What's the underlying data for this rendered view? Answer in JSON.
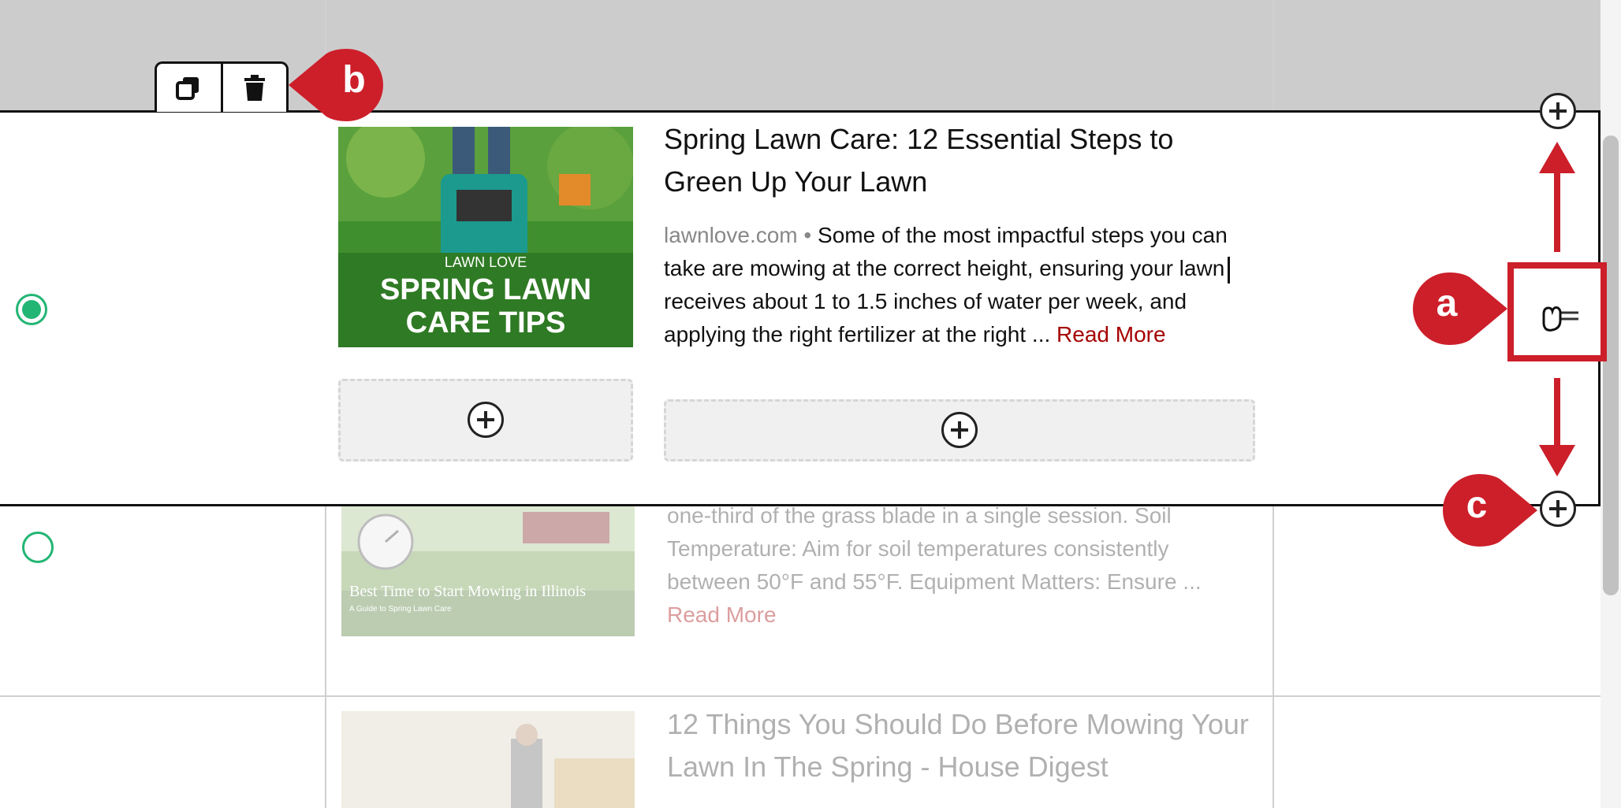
{
  "active_item": {
    "title": "Spring Lawn Care: 12 Essential Steps to Green Up Your Lawn",
    "title_line1": "Spring Lawn Care: 12 Essential Steps to",
    "title_line2": "Green Up Your Lawn",
    "source": "lawnlove.com",
    "separator": " • ",
    "snippet_line1": "Some of the most impactful steps you can",
    "snippet_line2": "take are mowing at the correct height, ensuring your lawn",
    "snippet_line3": "receives about 1 to 1.5 inches of water per week, and",
    "snippet_line4": "applying the right fertilizer at the right ...",
    "read_more": "Read More",
    "image": {
      "brand_text": "LAWN LOVE",
      "headline_line1": "SPRING LAWN",
      "headline_line2": "CARE TIPS"
    },
    "selected": true
  },
  "row_2": {
    "text_line1": "one-third of the grass blade in a single session. Soil",
    "text_line2": "Temperature: Aim for soil temperatures consistently",
    "text_line3": "between 50°F and 55°F. Equipment Matters: Ensure ...",
    "read_more": "Read More",
    "image": {
      "title": "Best Time to Start Mowing in Illinois",
      "subtitle": "A Guide to Spring Lawn Care"
    },
    "selected": false
  },
  "row_3": {
    "title_line1": "12 Things You Should Do Before Mowing Your",
    "title_line2": "Lawn In The Spring - House Digest"
  },
  "toolbar": {
    "duplicate_icon": "duplicate-icon",
    "delete_icon": "trash-icon"
  },
  "annotations": {
    "a": "a",
    "b": "b",
    "c": "c"
  },
  "colors": {
    "accent_red": "#cc1f2a",
    "radio_green": "#22b573",
    "read_more_red": "#a50000"
  }
}
